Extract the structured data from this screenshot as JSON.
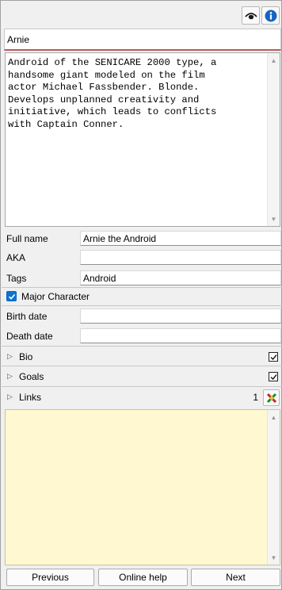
{
  "toolbar": {
    "view_icon": "eye-icon",
    "info_icon": "info-icon"
  },
  "title": "Arnie",
  "description": "Android of the SENICARE 2000 type, a\nhandsome giant modeled on the film\nactor Michael Fassbender. Blonde.\nDevelops unplanned creativity and\ninitiative, which leads to conflicts\nwith Captain Conner.",
  "fields": {
    "full_name_label": "Full name",
    "full_name_value": "Arnie the Android",
    "aka_label": "AKA",
    "aka_value": "",
    "tags_label": "Tags",
    "tags_value": "Android",
    "major_label": "Major Character",
    "major_checked": true,
    "birth_label": "Birth date",
    "birth_value": "",
    "death_label": "Death date",
    "death_value": ""
  },
  "sections": {
    "bio": "Bio",
    "goals": "Goals",
    "links": "Links",
    "links_count": "1"
  },
  "buttons": {
    "previous": "Previous",
    "online_help": "Online help",
    "next": "Next"
  },
  "colors": {
    "accent": "#0a74d6",
    "links_bg": "#fff8d0",
    "title_underline": "#b85b5b"
  }
}
